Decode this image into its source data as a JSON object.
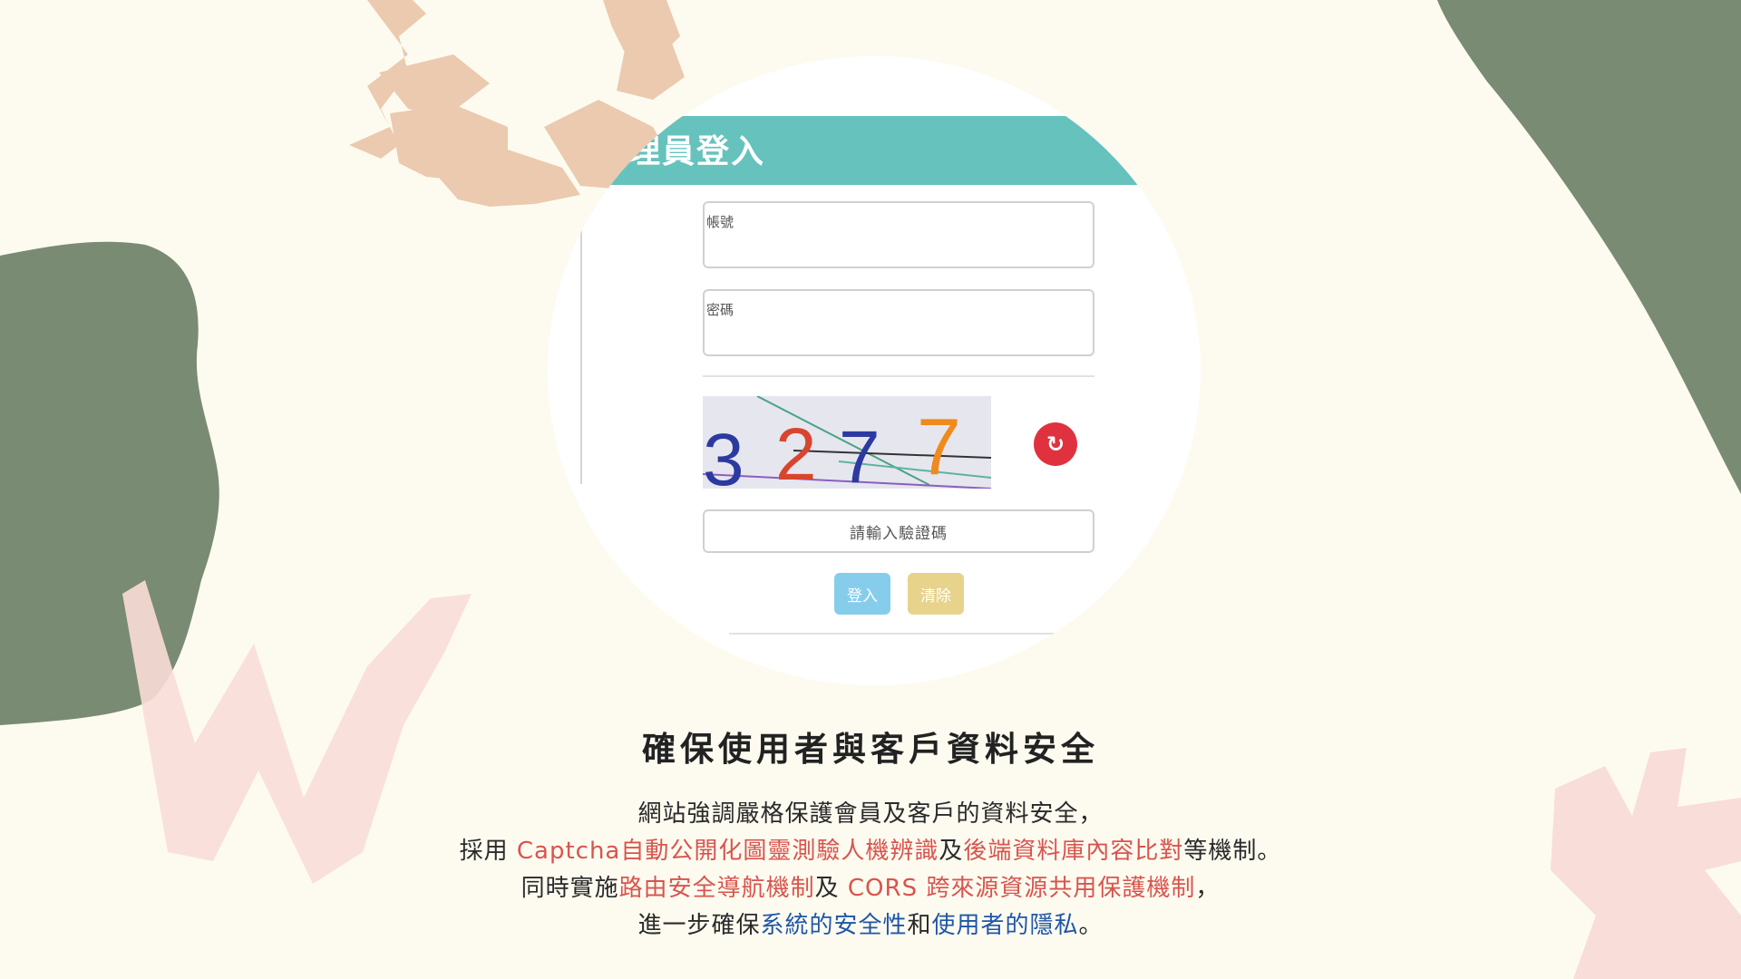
{
  "login": {
    "title": "管理員登入",
    "account_placeholder": "帳號",
    "password_placeholder": "密碼",
    "captcha_text": "3277",
    "refresh_icon": "refresh-icon",
    "captcha_placeholder": "請輸入驗證碼",
    "login_button": "登入",
    "clear_button": "清除"
  },
  "content": {
    "headline": "確保使用者與客戶資料安全",
    "line1": "網站強調嚴格保護會員及客戶的資料安全，",
    "line2_prefix": "採用 ",
    "line2_highlight1": "Captcha自動公開化圖靈測驗人機辨識",
    "line2_mid": "及",
    "line2_highlight2": "後端資料庫內容比對",
    "line2_suffix": "等機制。",
    "line3_prefix": "同時實施",
    "line3_highlight1": "路由安全導航機制",
    "line3_mid": "及 ",
    "line3_highlight2": "CORS 跨來源資源共用保護機制",
    "line3_suffix": "，",
    "line4_prefix": "進一步確保",
    "line4_highlight1": "系統的安全性",
    "line4_mid": "和",
    "line4_highlight2": "使用者的隱私",
    "line4_suffix": "。"
  },
  "colors": {
    "background": "#fdfbf0",
    "green_blob": "#7a8b73",
    "peach_shape": "#ebcab0",
    "pink_shape": "#f9ddd8",
    "header_teal": "#66c2bd",
    "highlight_red": "#d9544d",
    "highlight_blue": "#1f56a8"
  }
}
